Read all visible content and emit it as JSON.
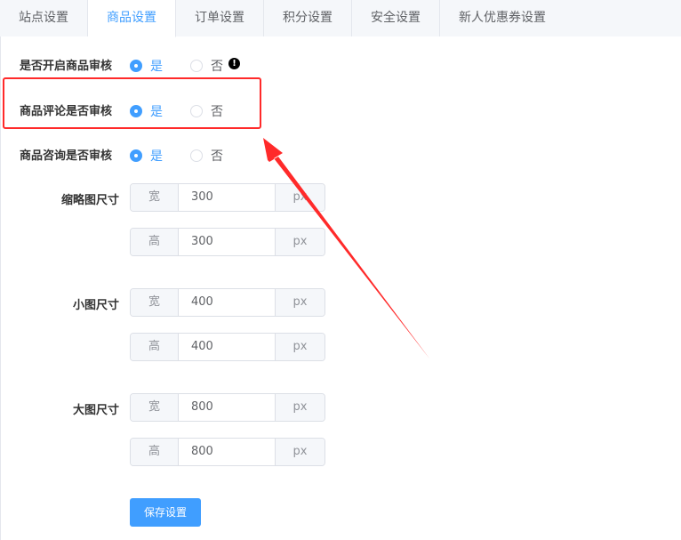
{
  "tabs": [
    {
      "label": "站点设置"
    },
    {
      "label": "商品设置"
    },
    {
      "label": "订单设置"
    },
    {
      "label": "积分设置"
    },
    {
      "label": "安全设置"
    },
    {
      "label": "新人优惠券设置"
    }
  ],
  "settings": {
    "goods_audit": {
      "label": "是否开启商品审核",
      "yes": "是",
      "no": "否",
      "selected": "是"
    },
    "comment_audit": {
      "label": "商品评论是否审核",
      "yes": "是",
      "no": "否",
      "selected": "是"
    },
    "consult_audit": {
      "label": "商品咨询是否审核",
      "yes": "是",
      "no": "否",
      "selected": "是"
    }
  },
  "warning_icon": "!",
  "sizes": {
    "thumb": {
      "label": "缩略图尺寸",
      "width_prefix": "宽",
      "width": "300",
      "height_prefix": "高",
      "height": "300",
      "unit": "px"
    },
    "small": {
      "label": "小图尺寸",
      "width_prefix": "宽",
      "width": "400",
      "height_prefix": "高",
      "height": "400",
      "unit": "px"
    },
    "large": {
      "label": "大图尺寸",
      "width_prefix": "宽",
      "width": "800",
      "height_prefix": "高",
      "height": "800",
      "unit": "px"
    }
  },
  "save_label": "保存设置",
  "colors": {
    "accent": "#409eff",
    "annotation": "#ff2a2a"
  }
}
